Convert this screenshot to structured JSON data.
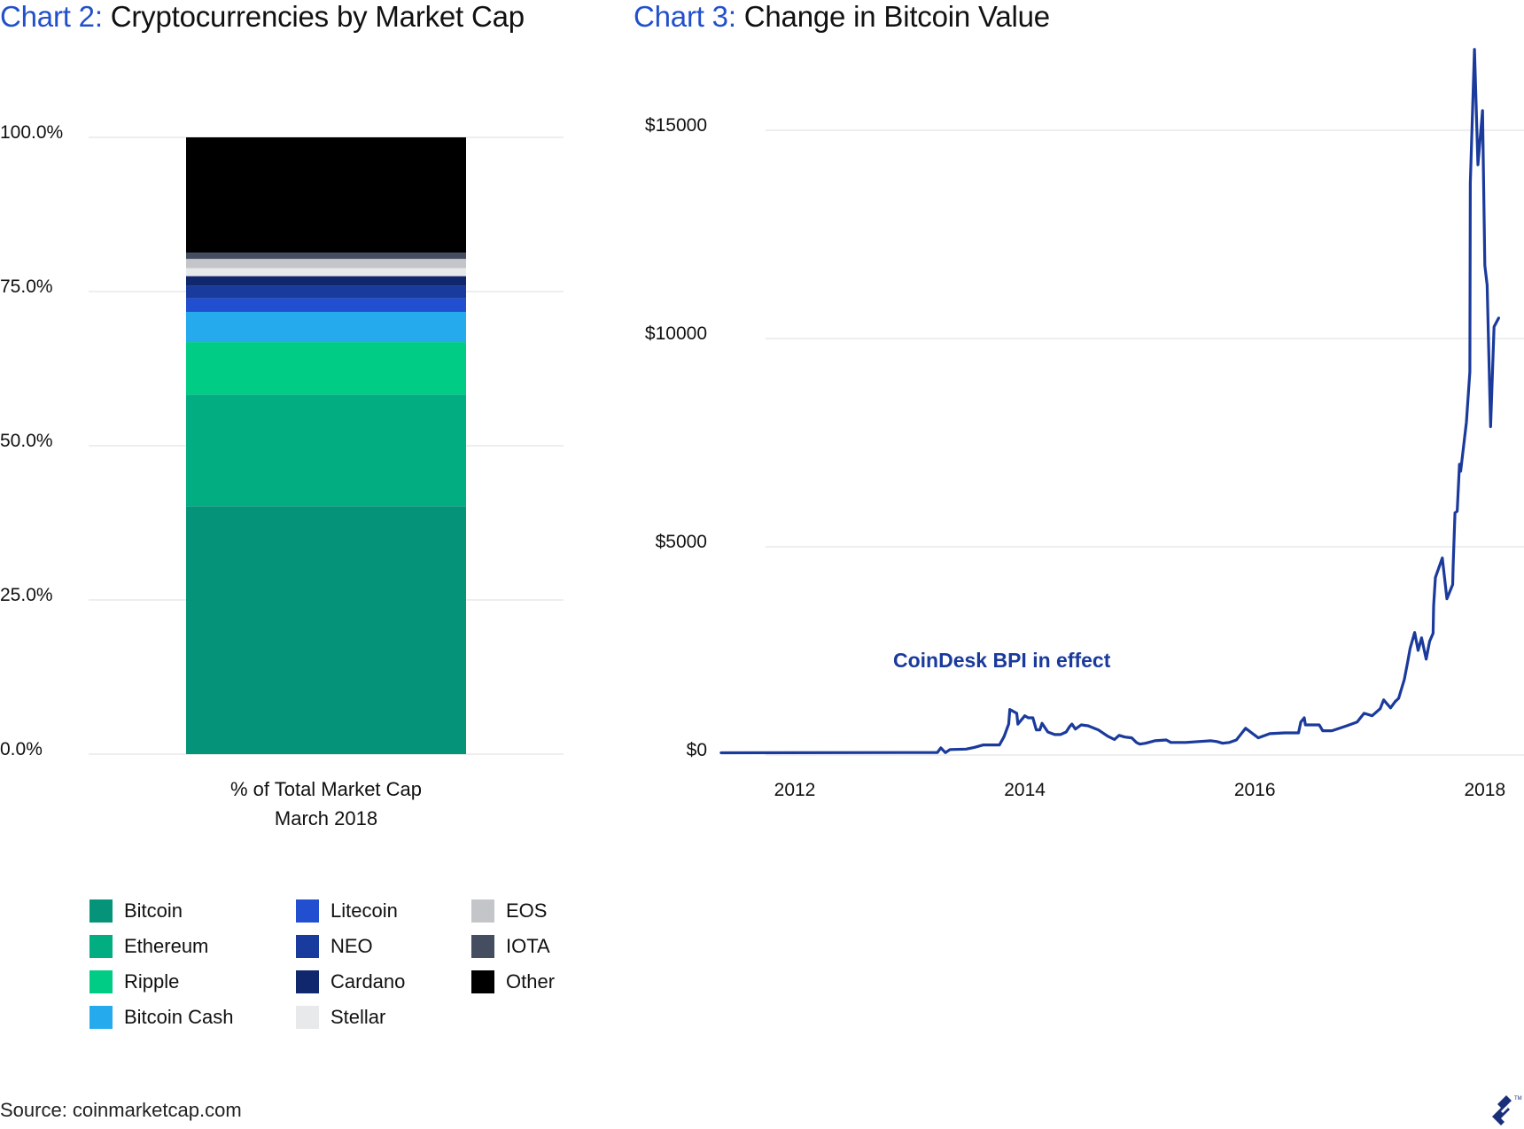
{
  "titles": {
    "chart2": {
      "prefix": "Chart 2:",
      "text": "Cryptocurrencies by Market Cap"
    },
    "chart3": {
      "prefix": "Chart 3:",
      "text": "Change in Bitcoin Value"
    }
  },
  "colors": {
    "title_accent": "#2250cc",
    "line": "#1a3a9c",
    "grid": "#e8e8e8"
  },
  "chart_data": [
    {
      "type": "bar",
      "stacked": true,
      "title": "Cryptocurrencies by Market Cap",
      "categories": [
        "% of Total Market Cap March 2018"
      ],
      "xlabel_lines": [
        "% of Total Market Cap",
        "March 2018"
      ],
      "ylabel": "",
      "ylim": [
        0,
        100
      ],
      "yticks": [
        "0.0%",
        "25.0%",
        "50.0%",
        "75.0%",
        "100.0%"
      ],
      "ytick_values": [
        0,
        25,
        50,
        75,
        100
      ],
      "grid": true,
      "legend_position": "bottom",
      "series": [
        {
          "name": "Bitcoin",
          "values": [
            40.2
          ],
          "color": "#059479"
        },
        {
          "name": "Ethereum",
          "values": [
            18.1
          ],
          "color": "#03ad82"
        },
        {
          "name": "Ripple",
          "values": [
            8.5
          ],
          "color": "#00cc85"
        },
        {
          "name": "Bitcoin Cash",
          "values": [
            4.9
          ],
          "color": "#25aaee"
        },
        {
          "name": "Litecoin",
          "values": [
            2.2
          ],
          "color": "#214fcf"
        },
        {
          "name": "NEO",
          "values": [
            2.0
          ],
          "color": "#1a3b9e"
        },
        {
          "name": "Cardano",
          "values": [
            1.6
          ],
          "color": "#10266d"
        },
        {
          "name": "Stellar",
          "values": [
            1.3
          ],
          "color": "#e8e9eb"
        },
        {
          "name": "EOS",
          "values": [
            1.5
          ],
          "color": "#c4c5c8"
        },
        {
          "name": "IOTA",
          "values": [
            1.0
          ],
          "color": "#444e60"
        },
        {
          "name": "Other",
          "values": [
            18.7
          ],
          "color": "#000000"
        }
      ],
      "legend_columns": [
        [
          "Bitcoin",
          "Ethereum",
          "Ripple",
          "Bitcoin Cash"
        ],
        [
          "Litecoin",
          "NEO",
          "Cardano",
          "Stellar"
        ],
        [
          "EOS",
          "IOTA",
          "Other"
        ]
      ]
    },
    {
      "type": "line",
      "title": "Change in Bitcoin Value",
      "xlabel": "",
      "ylabel": "",
      "xlim": [
        2011.36,
        2018.12
      ],
      "ylim": [
        0,
        17000
      ],
      "xticks": [
        "2012",
        "2014",
        "2016",
        "2018"
      ],
      "xtick_values": [
        2012,
        2014,
        2016,
        2018
      ],
      "yticks": [
        "$0",
        "$5000",
        "$10000",
        "$15000"
      ],
      "ytick_values": [
        0,
        5000,
        10000,
        15000
      ],
      "grid": true,
      "annotations": [
        {
          "text": "CoinDesk BPI in effect",
          "x": 2014.5,
          "y": 2000
        }
      ],
      "series": [
        {
          "name": "Bitcoin price (USD)",
          "points": [
            [
              2011.36,
              10
            ],
            [
              2013.24,
              20
            ],
            [
              2013.27,
              130
            ],
            [
              2013.31,
              15
            ],
            [
              2013.35,
              90
            ],
            [
              2013.49,
              100
            ],
            [
              2013.56,
              140
            ],
            [
              2013.64,
              200
            ],
            [
              2013.78,
              200
            ],
            [
              2013.82,
              400
            ],
            [
              2013.86,
              700
            ],
            [
              2013.87,
              1050
            ],
            [
              2013.93,
              960
            ],
            [
              2013.94,
              700
            ],
            [
              2014.0,
              900
            ],
            [
              2014.03,
              850
            ],
            [
              2014.07,
              850
            ],
            [
              2014.1,
              560
            ],
            [
              2014.13,
              560
            ],
            [
              2014.15,
              720
            ],
            [
              2014.2,
              510
            ],
            [
              2014.26,
              450
            ],
            [
              2014.31,
              450
            ],
            [
              2014.36,
              510
            ],
            [
              2014.39,
              640
            ],
            [
              2014.41,
              700
            ],
            [
              2014.44,
              580
            ],
            [
              2014.49,
              680
            ],
            [
              2014.55,
              660
            ],
            [
              2014.64,
              560
            ],
            [
              2014.72,
              410
            ],
            [
              2014.78,
              330
            ],
            [
              2014.82,
              430
            ],
            [
              2014.87,
              390
            ],
            [
              2014.93,
              370
            ],
            [
              2014.97,
              260
            ],
            [
              2015.0,
              220
            ],
            [
              2015.05,
              240
            ],
            [
              2015.13,
              300
            ],
            [
              2015.23,
              320
            ],
            [
              2015.27,
              260
            ],
            [
              2015.4,
              260
            ],
            [
              2015.51,
              280
            ],
            [
              2015.62,
              300
            ],
            [
              2015.67,
              280
            ],
            [
              2015.72,
              240
            ],
            [
              2015.78,
              260
            ],
            [
              2015.84,
              320
            ],
            [
              2015.92,
              600
            ],
            [
              2016.03,
              370
            ],
            [
              2016.13,
              470
            ],
            [
              2016.26,
              490
            ],
            [
              2016.38,
              490
            ],
            [
              2016.4,
              750
            ],
            [
              2016.43,
              850
            ],
            [
              2016.44,
              680
            ],
            [
              2016.56,
              680
            ],
            [
              2016.59,
              540
            ],
            [
              2016.67,
              540
            ],
            [
              2016.8,
              660
            ],
            [
              2016.89,
              750
            ],
            [
              2016.95,
              960
            ],
            [
              2017.02,
              900
            ],
            [
              2017.09,
              1070
            ],
            [
              2017.12,
              1280
            ],
            [
              2017.18,
              1090
            ],
            [
              2017.22,
              1240
            ],
            [
              2017.25,
              1320
            ],
            [
              2017.3,
              1770
            ],
            [
              2017.33,
              2200
            ],
            [
              2017.35,
              2510
            ],
            [
              2017.39,
              2900
            ],
            [
              2017.42,
              2470
            ],
            [
              2017.45,
              2770
            ],
            [
              2017.49,
              2260
            ],
            [
              2017.52,
              2690
            ],
            [
              2017.55,
              2880
            ],
            [
              2017.555,
              3540
            ],
            [
              2017.57,
              4220
            ],
            [
              2017.63,
              4690
            ],
            [
              2017.67,
              3710
            ],
            [
              2017.72,
              4050
            ],
            [
              2017.724,
              4480
            ],
            [
              2017.74,
              5770
            ],
            [
              2017.76,
              5810
            ],
            [
              2017.78,
              6940
            ],
            [
              2017.79,
              6770
            ],
            [
              2017.84,
              7950
            ],
            [
              2017.87,
              9160
            ],
            [
              2017.874,
              13690
            ],
            [
              2017.91,
              16900
            ],
            [
              2017.94,
              14130
            ],
            [
              2017.98,
              15430
            ],
            [
              2018.0,
              11710
            ],
            [
              2018.02,
              11240
            ],
            [
              2018.05,
              7840
            ],
            [
              2018.08,
              10240
            ],
            [
              2018.12,
              10450
            ]
          ]
        }
      ]
    }
  ],
  "footer": {
    "source": "Source: coinmarketcap.com",
    "logo_icon": "toptal-logo-icon"
  }
}
